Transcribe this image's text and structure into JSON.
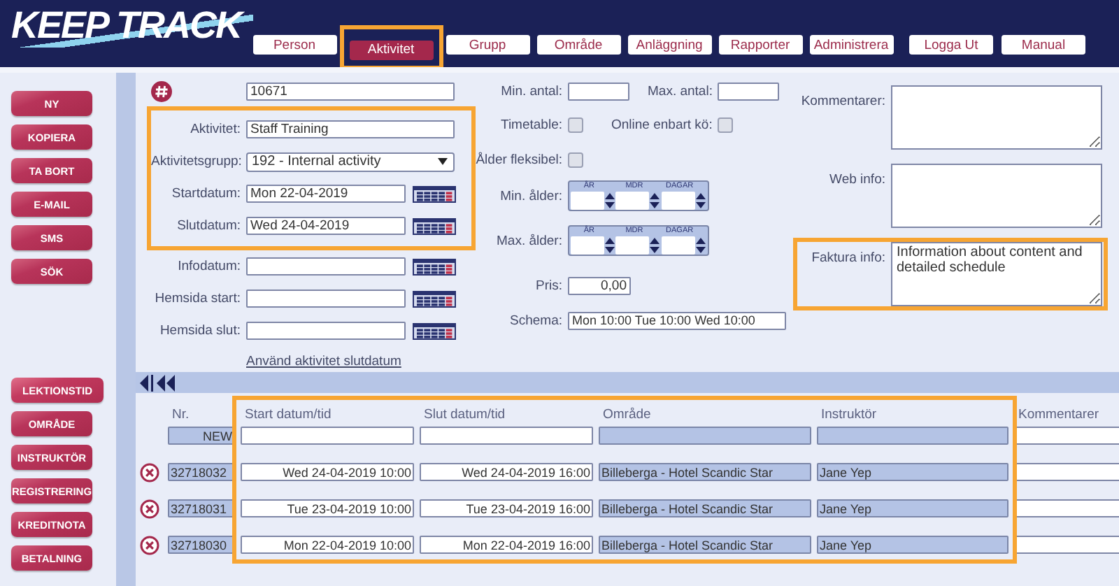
{
  "header": {
    "logo": "KEEP TRACK",
    "nav": [
      {
        "label": "Person",
        "selected": false,
        "highlighted": false
      },
      {
        "label": "Aktivitet",
        "selected": true,
        "highlighted": true
      },
      {
        "label": "Grupp",
        "selected": false,
        "highlighted": false
      },
      {
        "label": "Område",
        "selected": false,
        "highlighted": false
      },
      {
        "label": "Anläggning",
        "selected": false,
        "highlighted": false
      },
      {
        "label": "Rapporter",
        "selected": false,
        "highlighted": false
      },
      {
        "label": "Administrera",
        "selected": false,
        "highlighted": false
      }
    ],
    "account_nav": [
      "Logga Ut",
      "Manual"
    ]
  },
  "sidebar": {
    "actions": [
      {
        "label": "NY"
      },
      {
        "label": "KOPIERA"
      },
      {
        "label": "TA BORT"
      },
      {
        "label": "E-MAIL"
      },
      {
        "label": "SMS"
      },
      {
        "label": "SÖK"
      }
    ],
    "sections": [
      {
        "label": "LEKTIONSTID",
        "selected": true
      },
      {
        "label": "OMRÅDE",
        "selected": false
      },
      {
        "label": "INSTRUKTÖR",
        "selected": false
      },
      {
        "label": "REGISTRERING",
        "selected": false
      },
      {
        "label": "KREDITNOTA",
        "selected": false
      },
      {
        "label": "BETALNING",
        "selected": false
      }
    ]
  },
  "form": {
    "number": "10671",
    "main_group": {
      "highlighted": true,
      "fields": [
        {
          "label": "Aktivitet:",
          "kind": "text",
          "value": "Staff Training"
        },
        {
          "label": "Aktivitetsgrupp:",
          "kind": "select",
          "value": "192 - Internal activity"
        },
        {
          "label": "Startdatum:",
          "kind": "date",
          "value": "Mon 22-04-2019"
        },
        {
          "label": "Slutdatum:",
          "kind": "date",
          "value": "Wed 24-04-2019"
        }
      ]
    },
    "extra_fields": [
      {
        "label": "Infodatum:",
        "kind": "date"
      },
      {
        "label": "Hemsida start:",
        "kind": "date"
      },
      {
        "label": "Hemsida slut:",
        "kind": "date"
      }
    ],
    "link": "Använd aktivitet slutdatum",
    "min_count": {
      "label": "Min. antal:"
    },
    "max_count": {
      "label": "Max. antal:"
    },
    "checkboxes": [
      {
        "label": "Timetable:",
        "checked": false
      },
      {
        "label": "Online enbart kö:",
        "checked": false
      },
      {
        "label": "Ålder fleksibel:",
        "checked": false
      }
    ],
    "ages": [
      {
        "label": "Min. ålder:",
        "units": [
          "ÅR",
          "MDR",
          "DAGAR"
        ]
      },
      {
        "label": "Max. ålder:",
        "units": [
          "ÅR",
          "MDR",
          "DAGAR"
        ]
      }
    ],
    "price": {
      "label": "Pris:",
      "value": "0,00"
    },
    "schedule": {
      "label": "Schema:",
      "value": "Mon 10:00 Tue 10:00 Wed 10:00"
    },
    "notes": [
      {
        "label": "Kommentarer:",
        "highlighted": false
      },
      {
        "label": "Web info:",
        "highlighted": false
      },
      {
        "label": "Faktura info:",
        "value": "Information about content and detailed schedule",
        "highlighted": true
      }
    ]
  },
  "table": {
    "columns": [
      {
        "label": "Nr.",
        "highlighted": false
      },
      {
        "label": "Start datum/tid",
        "highlighted": true
      },
      {
        "label": "Slut datum/tid",
        "highlighted": true
      },
      {
        "label": "Område",
        "highlighted": true
      },
      {
        "label": "Instruktör",
        "highlighted": true
      },
      {
        "label": "Kommentarer",
        "highlighted": false
      }
    ],
    "rows": [
      {
        "kind": "new",
        "nr": "NEW"
      },
      {
        "kind": "entry",
        "nr": "32718032",
        "start": "Wed 24-04-2019 10:00",
        "end": "Wed 24-04-2019 16:00",
        "area": "Billeberga - Hotel Scandic Star",
        "instructor": "Jane Yep"
      },
      {
        "kind": "entry",
        "nr": "32718031",
        "start": "Tue 23-04-2019 10:00",
        "end": "Tue 23-04-2019 16:00",
        "area": "Billeberga - Hotel Scandic Star",
        "instructor": "Jane Yep"
      },
      {
        "kind": "entry",
        "nr": "32718030",
        "start": "Mon 22-04-2019 10:00",
        "end": "Mon 22-04-2019 16:00",
        "area": "Billeberga - Hotel Scandic Star",
        "instructor": "Jane Yep"
      }
    ]
  }
}
